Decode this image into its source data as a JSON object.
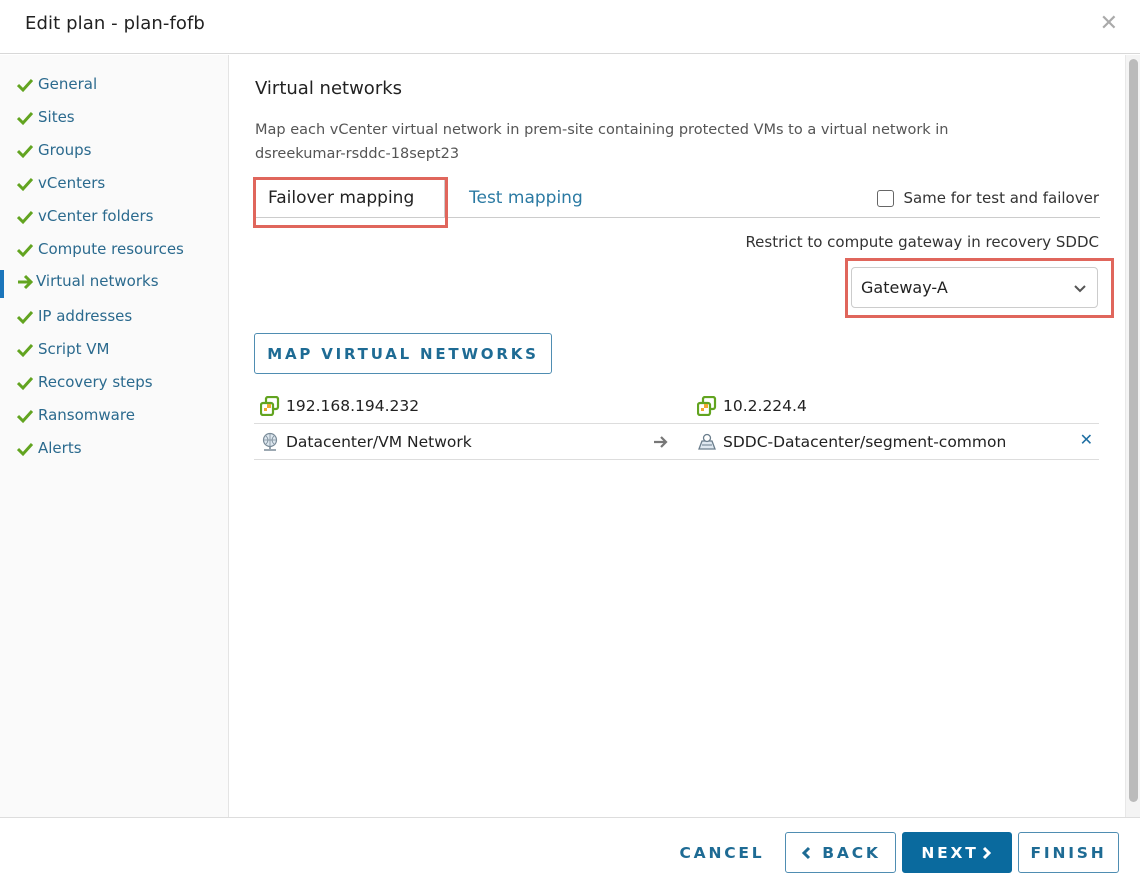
{
  "dialog": {
    "title": "Edit plan - plan-fofb",
    "close_icon": "close-icon"
  },
  "sidebar": {
    "items": [
      {
        "label": "General",
        "status": "complete"
      },
      {
        "label": "Sites",
        "status": "complete"
      },
      {
        "label": "Groups",
        "status": "complete"
      },
      {
        "label": "vCenters",
        "status": "complete"
      },
      {
        "label": "vCenter folders",
        "status": "complete"
      },
      {
        "label": "Compute resources",
        "status": "complete"
      },
      {
        "label": "Virtual networks",
        "status": "current"
      },
      {
        "label": "IP addresses",
        "status": "complete"
      },
      {
        "label": "Script VM",
        "status": "complete"
      },
      {
        "label": "Recovery steps",
        "status": "complete"
      },
      {
        "label": "Ransomware",
        "status": "complete"
      },
      {
        "label": "Alerts",
        "status": "complete"
      }
    ]
  },
  "main": {
    "section_title": "Virtual networks",
    "description": "Map each vCenter virtual network in prem-site containing protected VMs to a virtual network in dsreekumar-rsddc-18sept23",
    "tabs": [
      {
        "label": "Failover mapping",
        "active": true
      },
      {
        "label": "Test mapping",
        "active": false
      }
    ],
    "same_for_test_checkbox": {
      "label": "Same for test and failover",
      "checked": false
    },
    "restrict_label": "Restrict to compute gateway in recovery SDDC",
    "gateway_select": {
      "value": "Gateway-A"
    },
    "map_button_label": "MAP VIRTUAL NETWORKS",
    "mapping": {
      "source_vcenter": "192.168.194.232",
      "target_vcenter": "10.2.224.4",
      "rows": [
        {
          "source": "Datacenter/VM Network",
          "target": "SDDC-Datacenter/segment-common"
        }
      ]
    }
  },
  "footer": {
    "cancel": "CANCEL",
    "back": "BACK",
    "next": "NEXT",
    "finish": "FINISH"
  },
  "colors": {
    "accent": "#0a6a9e",
    "link": "#2b6a8e",
    "check": "#62a420",
    "highlight": "#e0665c"
  }
}
